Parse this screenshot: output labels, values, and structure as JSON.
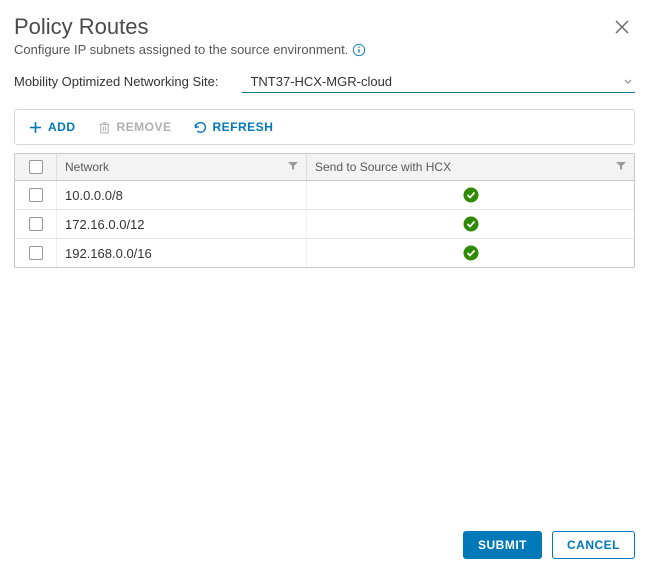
{
  "header": {
    "title": "Policy Routes",
    "subtitle": "Configure IP subnets assigned to the source environment."
  },
  "site": {
    "label": "Mobility Optimized Networking Site:",
    "selected": "TNT37-HCX-MGR-cloud"
  },
  "toolbar": {
    "add_label": "ADD",
    "remove_label": "REMOVE",
    "refresh_label": "REFRESH"
  },
  "table": {
    "columns": {
      "network": "Network",
      "send_source": "Send to Source with HCX"
    },
    "rows": [
      {
        "network": "10.0.0.0/8",
        "status": "ok"
      },
      {
        "network": "172.16.0.0/12",
        "status": "ok"
      },
      {
        "network": "192.168.0.0/16",
        "status": "ok"
      }
    ]
  },
  "footer": {
    "submit_label": "SUBMIT",
    "cancel_label": "CANCEL"
  }
}
